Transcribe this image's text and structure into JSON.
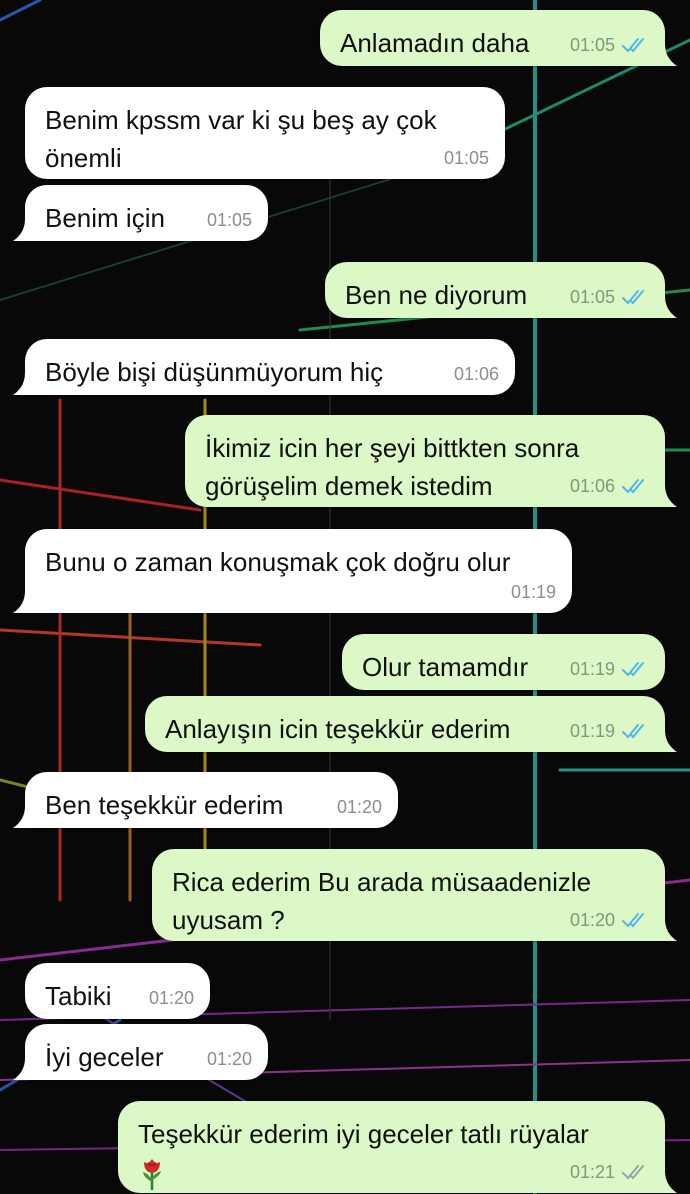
{
  "chat": {
    "messages": [
      {
        "id": "m1",
        "dir": "outgoing",
        "text": "Anlamadın daha",
        "time": "01:05",
        "status": "read"
      },
      {
        "id": "m2",
        "dir": "incoming",
        "text": "Benim kpssm var ki şu beş ay çok\nönemli",
        "time": "01:05"
      },
      {
        "id": "m3",
        "dir": "incoming",
        "text": "Benim için",
        "time": "01:05"
      },
      {
        "id": "m4",
        "dir": "outgoing",
        "text": "Ben ne diyorum",
        "time": "01:05",
        "status": "read"
      },
      {
        "id": "m5",
        "dir": "incoming",
        "text": "Böyle bişi düşünmüyorum hiç",
        "time": "01:06"
      },
      {
        "id": "m6",
        "dir": "outgoing",
        "text": "İkimiz icin her şeyi bittkten sonra\ngörüşelim demek istedim",
        "time": "01:06",
        "status": "read"
      },
      {
        "id": "m7",
        "dir": "incoming",
        "text": "Bunu o zaman konuşmak çok doğru olur",
        "time": "01:19"
      },
      {
        "id": "m8",
        "dir": "outgoing",
        "text": "Olur tamamdır",
        "time": "01:19",
        "status": "read"
      },
      {
        "id": "m9",
        "dir": "outgoing",
        "text": "Anlayışın icin teşekkür ederim",
        "time": "01:19",
        "status": "read"
      },
      {
        "id": "m10",
        "dir": "incoming",
        "text": "Ben teşekkür ederim",
        "time": "01:20"
      },
      {
        "id": "m11",
        "dir": "outgoing",
        "text": "Rica ederim Bu arada müsaadenizle\nuyusam ?",
        "time": "01:20",
        "status": "read"
      },
      {
        "id": "m12",
        "dir": "incoming",
        "text": "Tabiki",
        "time": "01:20"
      },
      {
        "id": "m13",
        "dir": "incoming",
        "text": "İyi geceler",
        "time": "01:20"
      },
      {
        "id": "m14",
        "dir": "outgoing",
        "text": "Teşekkür ederim iyi geceler tatlı rüyalar",
        "emoji": "rose",
        "time": "01:21",
        "status": "delivered"
      }
    ]
  },
  "colors": {
    "incoming_bubble": "#ffffff",
    "outgoing_bubble": "#dcf8c6",
    "tick_read": "#4fb6ec",
    "tick_delivered": "#9aa3a8",
    "wallpaper": "#080808"
  }
}
